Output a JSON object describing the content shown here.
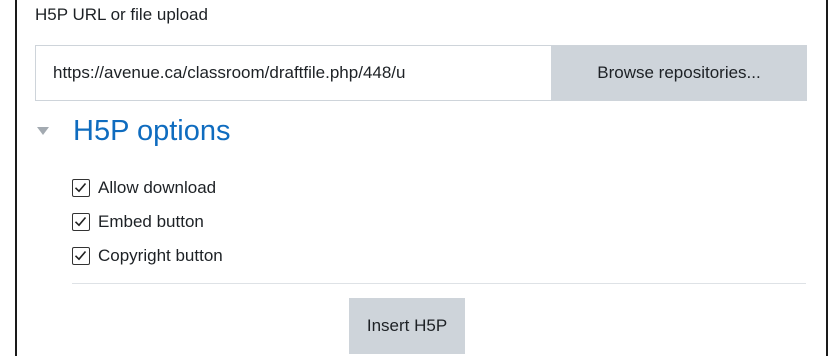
{
  "file_field": {
    "label": "H5P URL or file upload",
    "url_value": "https://avenue.ca/classroom/draftfile.php/448/u",
    "browse_label": "Browse repositories..."
  },
  "options_section": {
    "title": "H5P options",
    "expanded": true,
    "options": [
      {
        "label": "Allow download",
        "checked": true
      },
      {
        "label": "Embed button",
        "checked": true
      },
      {
        "label": "Copyright button",
        "checked": true
      }
    ]
  },
  "actions": {
    "insert_label": "Insert H5P"
  },
  "colors": {
    "section_title": "#0f6cbf",
    "button_bg": "#ced4da",
    "caret": "#a3aab1"
  },
  "icons": {
    "caret": "caret-down-icon",
    "checkbox": "check-icon"
  }
}
